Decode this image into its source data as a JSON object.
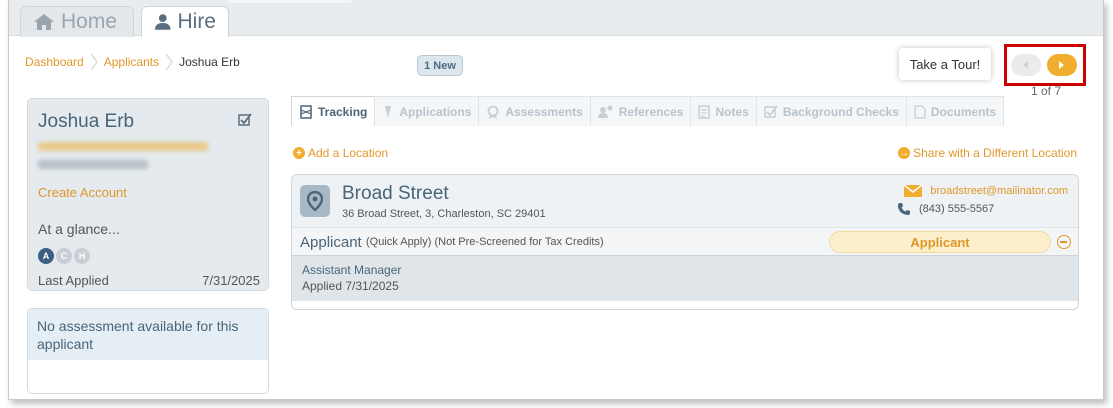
{
  "top_tabs": [
    {
      "label": "Home",
      "icon": "home-icon"
    },
    {
      "label": "Hire",
      "icon": "user-icon"
    }
  ],
  "breadcrumb": [
    "Dashboard",
    "Applicants",
    "Joshua Erb"
  ],
  "new_badge": "1 New",
  "tour_button": "Take a Tour!",
  "pager": "1 of 7",
  "profile": {
    "name": "Joshua Erb",
    "create_account": "Create Account",
    "at_a_glance": "At a glance...",
    "indicators": [
      "A",
      "C",
      "H"
    ],
    "last_applied_label": "Last Applied",
    "last_applied_value": "7/31/2025"
  },
  "assessment_card": {
    "text": "No assessment available for this applicant"
  },
  "section_tabs": [
    {
      "label": "Tracking",
      "icon": "tracking-icon",
      "active": true
    },
    {
      "label": "Applications",
      "icon": "pen-icon",
      "active": false
    },
    {
      "label": "Assessments",
      "icon": "award-icon",
      "active": false
    },
    {
      "label": "References",
      "icon": "references-icon",
      "active": false
    },
    {
      "label": "Notes",
      "icon": "notes-icon",
      "active": false
    },
    {
      "label": "Background Checks",
      "icon": "check-icon",
      "active": false
    },
    {
      "label": "Documents",
      "icon": "document-icon",
      "active": false
    }
  ],
  "add_location": "Add a Location",
  "share_location": "Share with a Different Location",
  "location": {
    "name": "Broad Street",
    "address": "36 Broad Street, 3, Charleston, SC 29401",
    "email": "broadstreet@mailinator.com",
    "phone": "(843) 555-5567",
    "applicant_label": "Applicant",
    "applicant_meta": "(Quick Apply)  (Not Pre-Screened for Tax Credits)",
    "status": "Applicant",
    "position": "Assistant Manager",
    "applied": "Applied 7/31/2025"
  },
  "colors": {
    "accent_orange": "#e0972a",
    "slate_blue": "#4a6478",
    "highlight_red": "#cc0000"
  }
}
